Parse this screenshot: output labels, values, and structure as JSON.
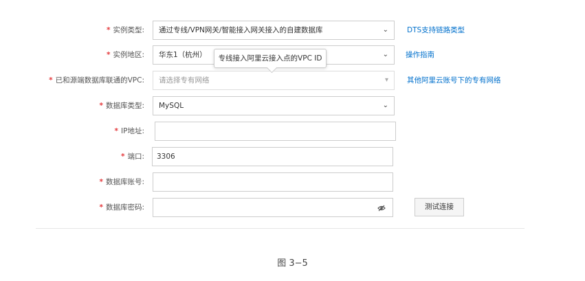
{
  "form": {
    "instance_type": {
      "label": "实例类型:",
      "value": "通过专线/VPN网关/智能接入网关接入的自建数据库",
      "link": "DTS支持链路类型"
    },
    "instance_region": {
      "label": "实例地区:",
      "value": "华东1（杭州）",
      "link": "操作指南"
    },
    "tooltip": "专线接入阿里云接入点的VPC ID",
    "vpc": {
      "label": "已和源端数据库联通的VPC:",
      "placeholder": "请选择专有网络",
      "link": "其他阿里云账号下的专有网络"
    },
    "db_type": {
      "label": "数据库类型:",
      "value": "MySQL"
    },
    "ip": {
      "label": "IP地址:",
      "value": ""
    },
    "port": {
      "label": "端口:",
      "value": "3306"
    },
    "account": {
      "label": "数据库账号:",
      "value": ""
    },
    "password": {
      "label": "数据库密码:",
      "value": ""
    },
    "test_button": "测试连接",
    "required_mark": "*"
  },
  "icons": {
    "select_arrow": "chevron-down-icon",
    "password_toggle": "eye-icon"
  },
  "colors": {
    "required": "#e4393c",
    "link": "#0070cc"
  },
  "caption": "图 3−5"
}
